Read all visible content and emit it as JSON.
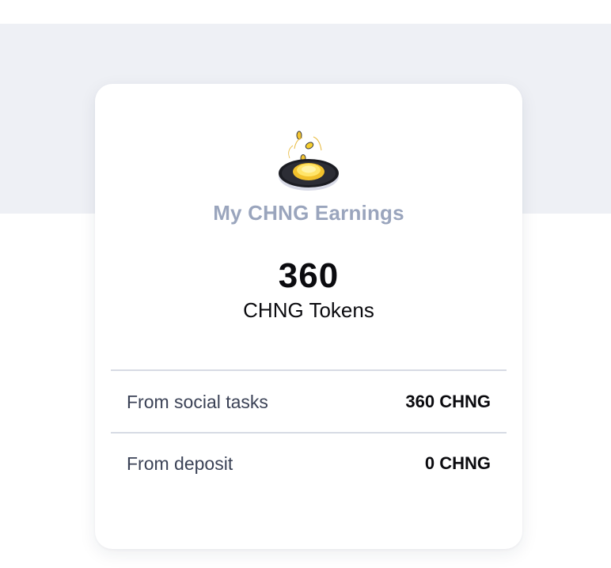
{
  "earnings": {
    "title": "My CHNG Earnings",
    "total_amount": "360",
    "total_unit": "CHNG Tokens",
    "icon": "coin-stack-icon",
    "breakdown": [
      {
        "label": "From social tasks",
        "value": "360 CHNG"
      },
      {
        "label": "From deposit",
        "value": "0 CHNG"
      }
    ]
  },
  "colors": {
    "background_band": "#eef0f5",
    "card": "#ffffff",
    "title": "#9aa5bd",
    "coin_gold": "#f7cf2e",
    "text_dark": "#0b0b0f"
  }
}
